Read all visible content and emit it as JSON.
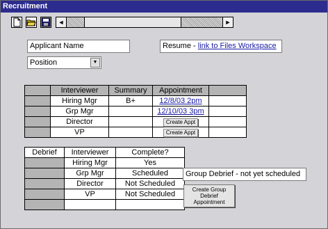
{
  "window": {
    "title": "Recruitment"
  },
  "toolbar": {
    "left_arrow": "◄",
    "right_arrow": "►"
  },
  "applicant_name": "Applicant Name",
  "resume": {
    "label": "Resume - ",
    "link": "link to Files Workspace"
  },
  "position": {
    "value": "Position",
    "arrow": "▼"
  },
  "interviews": {
    "headers": {
      "interviewer": "Interviewer",
      "summary": "Summary",
      "appointment": "Appointment"
    },
    "rows": [
      {
        "interviewer": "Hiring Mgr",
        "summary": "B+",
        "appointment": "12/8/03 2pm"
      },
      {
        "interviewer": "Grp Mgr",
        "summary": "",
        "appointment": "12/10/03 3pm"
      },
      {
        "interviewer": "Director",
        "summary": "",
        "button": "Create Appt"
      },
      {
        "interviewer": "VP",
        "summary": "",
        "button": "Create Appt"
      }
    ]
  },
  "debrief": {
    "headers": {
      "debrief": "Debrief",
      "interviewer": "Interviewer",
      "complete": "Complete?"
    },
    "rows": [
      {
        "interviewer": "Hiring Mgr",
        "complete": "Yes"
      },
      {
        "interviewer": "Grp Mgr",
        "complete": "Scheduled"
      },
      {
        "interviewer": "Director",
        "complete": "Not Scheduled"
      },
      {
        "interviewer": "VP",
        "complete": "Not Scheduled"
      },
      {
        "interviewer": "",
        "complete": ""
      }
    ]
  },
  "group_debrief": {
    "status": "Group Debrief - not yet scheduled",
    "button_line1": "Create Group",
    "button_line2": "Debrief",
    "button_line3": "Appointment"
  }
}
